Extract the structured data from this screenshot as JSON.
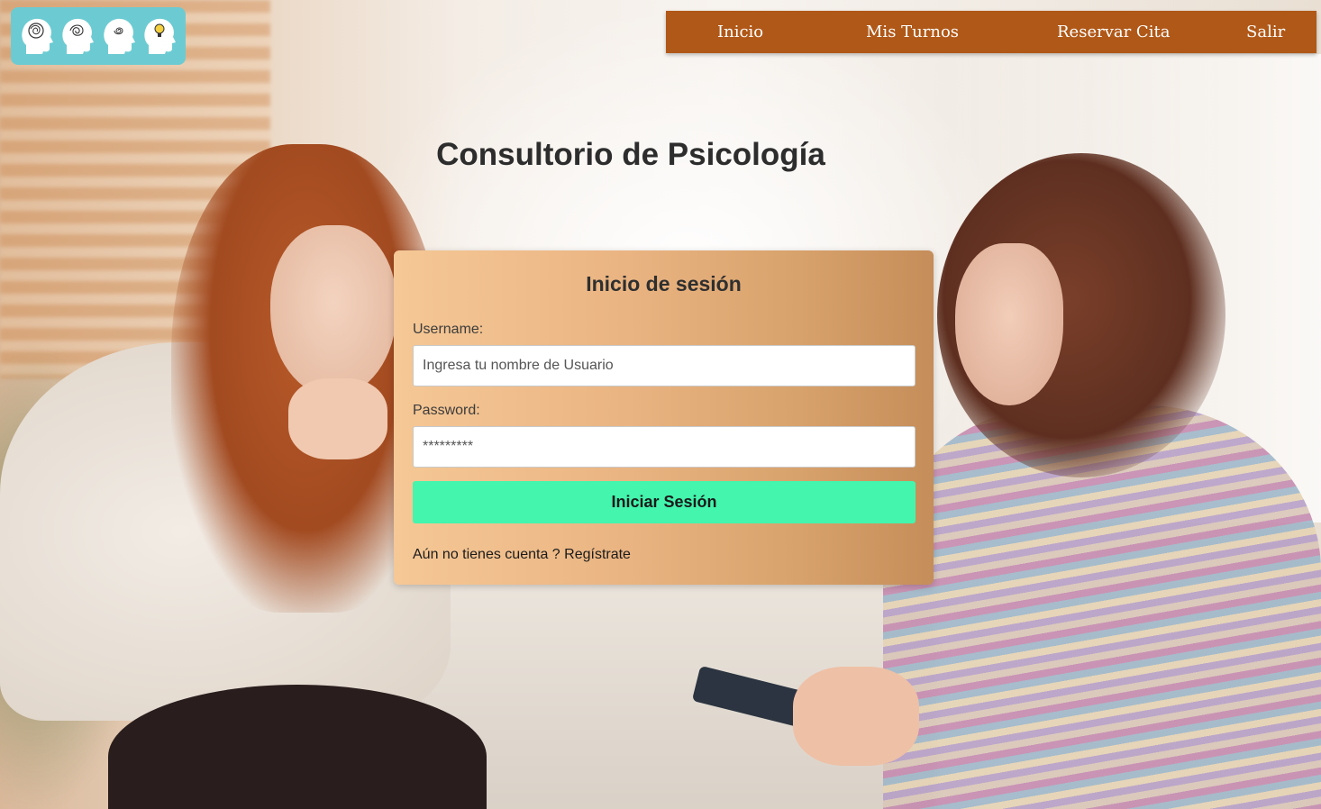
{
  "nav": {
    "items": [
      {
        "label": "Inicio"
      },
      {
        "label": "Mis Turnos"
      },
      {
        "label": "Reservar Cita"
      },
      {
        "label": "Salir"
      }
    ]
  },
  "page": {
    "title": "Consultorio de Psicología"
  },
  "login": {
    "title": "Inicio de sesión",
    "username_label": "Username:",
    "username_placeholder": "Ingresa tu nombre de Usuario",
    "password_label": "Password:",
    "password_placeholder": "*********",
    "submit_label": "Iniciar Sesión",
    "signup_prompt": "Aún no tienes cuenta ?",
    "signup_link": "Regístrate"
  },
  "colors": {
    "nav_bg": "#b05818",
    "logo_bg": "#6ccbd2",
    "submit_bg": "#43f5ad",
    "card_gradient_start": "#f5c896",
    "card_gradient_end": "#c58d59"
  },
  "icons": {
    "logo": "mind-heads-logo"
  }
}
